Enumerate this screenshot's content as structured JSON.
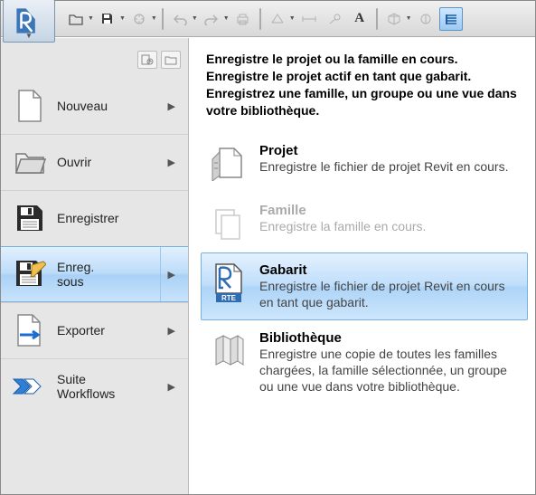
{
  "left_menu": {
    "items": [
      {
        "label": "Nouveau"
      },
      {
        "label": "Ouvrir"
      },
      {
        "label": "Enregistrer"
      },
      {
        "label": "Enreg.\nsous"
      },
      {
        "label": "Exporter"
      },
      {
        "label": "Suite\nWorkflows"
      }
    ]
  },
  "right_panel": {
    "header": "Enregistre le projet ou la famille en cours. Enregistre le projet actif en tant que gabarit. Enregistrez une famille, un groupe ou une vue dans votre bibliothèque.",
    "items": [
      {
        "title": "Projet",
        "desc": "Enregistre le fichier de projet Revit en cours."
      },
      {
        "title": "Famille",
        "desc": "Enregistre la famille en cours."
      },
      {
        "title": "Gabarit",
        "desc": "Enregistre le fichier de projet Revit en cours en tant que gabarit."
      },
      {
        "title": "Bibliothèque",
        "desc": "Enregistre une copie de toutes les familles chargées, la famille sélectionnée, un groupe ou une vue dans votre bibliothèque."
      }
    ]
  },
  "rte_badge": "RTE"
}
